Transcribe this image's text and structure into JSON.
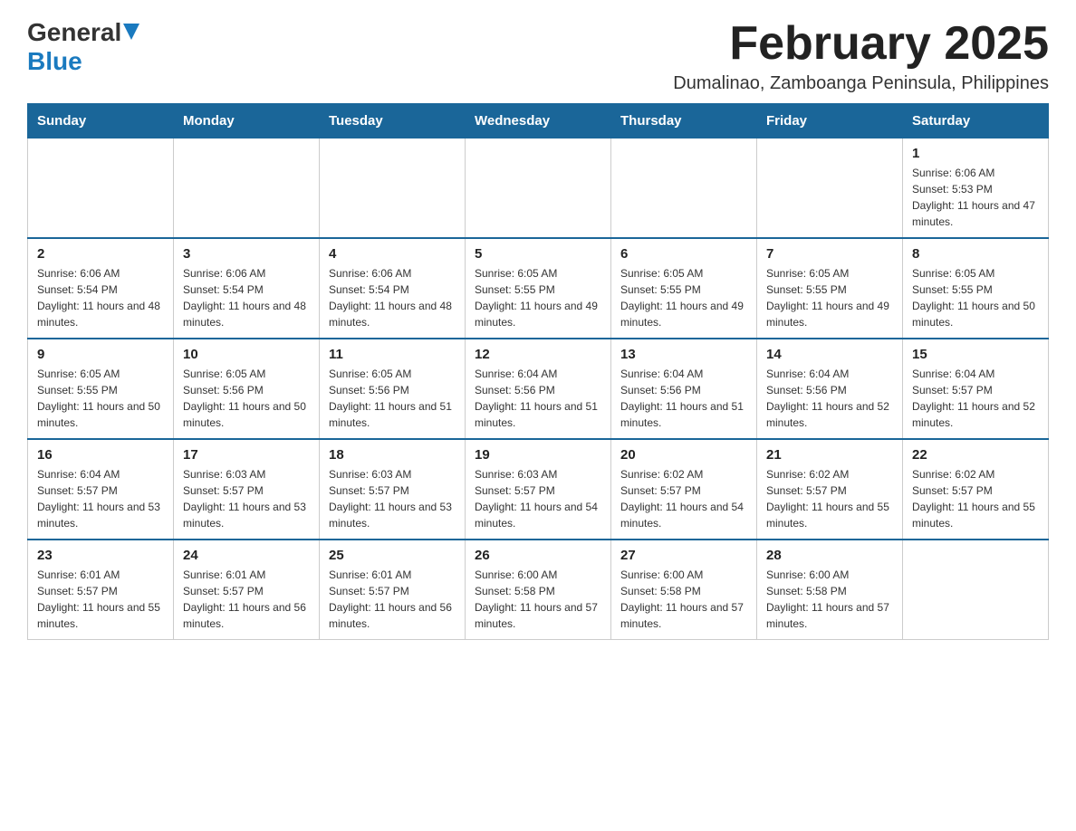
{
  "header": {
    "logo_general": "General",
    "logo_blue": "Blue",
    "month_title": "February 2025",
    "location": "Dumalinao, Zamboanga Peninsula, Philippines"
  },
  "days_of_week": [
    "Sunday",
    "Monday",
    "Tuesday",
    "Wednesday",
    "Thursday",
    "Friday",
    "Saturday"
  ],
  "weeks": [
    [
      {
        "day": "",
        "info": ""
      },
      {
        "day": "",
        "info": ""
      },
      {
        "day": "",
        "info": ""
      },
      {
        "day": "",
        "info": ""
      },
      {
        "day": "",
        "info": ""
      },
      {
        "day": "",
        "info": ""
      },
      {
        "day": "1",
        "info": "Sunrise: 6:06 AM\nSunset: 5:53 PM\nDaylight: 11 hours and 47 minutes."
      }
    ],
    [
      {
        "day": "2",
        "info": "Sunrise: 6:06 AM\nSunset: 5:54 PM\nDaylight: 11 hours and 48 minutes."
      },
      {
        "day": "3",
        "info": "Sunrise: 6:06 AM\nSunset: 5:54 PM\nDaylight: 11 hours and 48 minutes."
      },
      {
        "day": "4",
        "info": "Sunrise: 6:06 AM\nSunset: 5:54 PM\nDaylight: 11 hours and 48 minutes."
      },
      {
        "day": "5",
        "info": "Sunrise: 6:05 AM\nSunset: 5:55 PM\nDaylight: 11 hours and 49 minutes."
      },
      {
        "day": "6",
        "info": "Sunrise: 6:05 AM\nSunset: 5:55 PM\nDaylight: 11 hours and 49 minutes."
      },
      {
        "day": "7",
        "info": "Sunrise: 6:05 AM\nSunset: 5:55 PM\nDaylight: 11 hours and 49 minutes."
      },
      {
        "day": "8",
        "info": "Sunrise: 6:05 AM\nSunset: 5:55 PM\nDaylight: 11 hours and 50 minutes."
      }
    ],
    [
      {
        "day": "9",
        "info": "Sunrise: 6:05 AM\nSunset: 5:55 PM\nDaylight: 11 hours and 50 minutes."
      },
      {
        "day": "10",
        "info": "Sunrise: 6:05 AM\nSunset: 5:56 PM\nDaylight: 11 hours and 50 minutes."
      },
      {
        "day": "11",
        "info": "Sunrise: 6:05 AM\nSunset: 5:56 PM\nDaylight: 11 hours and 51 minutes."
      },
      {
        "day": "12",
        "info": "Sunrise: 6:04 AM\nSunset: 5:56 PM\nDaylight: 11 hours and 51 minutes."
      },
      {
        "day": "13",
        "info": "Sunrise: 6:04 AM\nSunset: 5:56 PM\nDaylight: 11 hours and 51 minutes."
      },
      {
        "day": "14",
        "info": "Sunrise: 6:04 AM\nSunset: 5:56 PM\nDaylight: 11 hours and 52 minutes."
      },
      {
        "day": "15",
        "info": "Sunrise: 6:04 AM\nSunset: 5:57 PM\nDaylight: 11 hours and 52 minutes."
      }
    ],
    [
      {
        "day": "16",
        "info": "Sunrise: 6:04 AM\nSunset: 5:57 PM\nDaylight: 11 hours and 53 minutes."
      },
      {
        "day": "17",
        "info": "Sunrise: 6:03 AM\nSunset: 5:57 PM\nDaylight: 11 hours and 53 minutes."
      },
      {
        "day": "18",
        "info": "Sunrise: 6:03 AM\nSunset: 5:57 PM\nDaylight: 11 hours and 53 minutes."
      },
      {
        "day": "19",
        "info": "Sunrise: 6:03 AM\nSunset: 5:57 PM\nDaylight: 11 hours and 54 minutes."
      },
      {
        "day": "20",
        "info": "Sunrise: 6:02 AM\nSunset: 5:57 PM\nDaylight: 11 hours and 54 minutes."
      },
      {
        "day": "21",
        "info": "Sunrise: 6:02 AM\nSunset: 5:57 PM\nDaylight: 11 hours and 55 minutes."
      },
      {
        "day": "22",
        "info": "Sunrise: 6:02 AM\nSunset: 5:57 PM\nDaylight: 11 hours and 55 minutes."
      }
    ],
    [
      {
        "day": "23",
        "info": "Sunrise: 6:01 AM\nSunset: 5:57 PM\nDaylight: 11 hours and 55 minutes."
      },
      {
        "day": "24",
        "info": "Sunrise: 6:01 AM\nSunset: 5:57 PM\nDaylight: 11 hours and 56 minutes."
      },
      {
        "day": "25",
        "info": "Sunrise: 6:01 AM\nSunset: 5:57 PM\nDaylight: 11 hours and 56 minutes."
      },
      {
        "day": "26",
        "info": "Sunrise: 6:00 AM\nSunset: 5:58 PM\nDaylight: 11 hours and 57 minutes."
      },
      {
        "day": "27",
        "info": "Sunrise: 6:00 AM\nSunset: 5:58 PM\nDaylight: 11 hours and 57 minutes."
      },
      {
        "day": "28",
        "info": "Sunrise: 6:00 AM\nSunset: 5:58 PM\nDaylight: 11 hours and 57 minutes."
      },
      {
        "day": "",
        "info": ""
      }
    ]
  ]
}
